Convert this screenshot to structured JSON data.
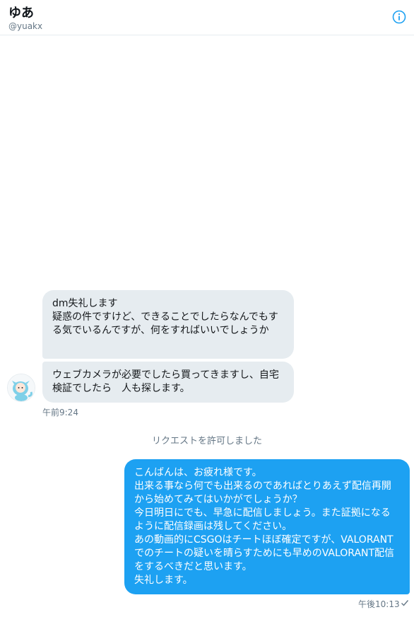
{
  "header": {
    "name": "ゆあ",
    "handle": "@yuakx"
  },
  "messages": {
    "in1": "dm失礼します\n疑惑の件ですけど、できることでしたらなんでもする気でいるんですが、何をすればいいでしょうか",
    "in2": "ウェブカメラが必要でしたら買ってきますし、自宅検証でしたら　人も探します。",
    "in_time": "午前9:24",
    "system": "リクエストを許可しました",
    "out": "こんばんは、お疲れ様です。\n出来る事なら何でも出来るのであればとりあえず配信再開から始めてみてはいかがでしょうか？\n今日明日にでも、早急に配信しましょう。また証拠になるように配信録画は残してください。\nあの動画的にCSGOはチートほぼ確定ですが、VALORANTでのチートの疑いを晴らすためにも早めのVALORANT配信をするべきだと思います。\n失礼します。",
    "out_time": "午後10:13"
  },
  "icons": {
    "info": "info-icon",
    "check": "checkmark-icon",
    "avatar": "avatar"
  },
  "colors": {
    "accent": "#1da1f2",
    "incoming_bubble": "#e6ecf0"
  }
}
